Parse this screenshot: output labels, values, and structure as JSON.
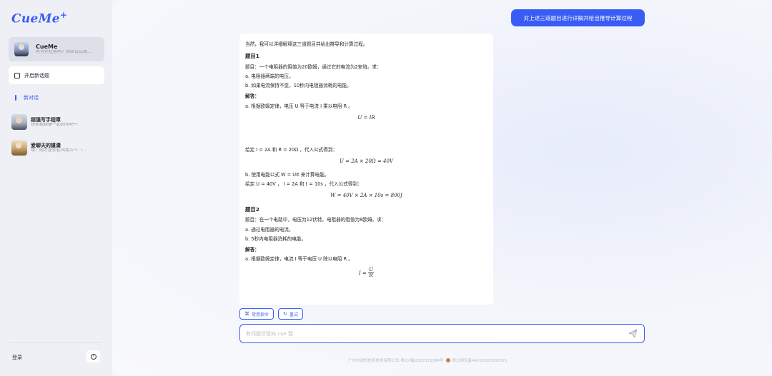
{
  "brand": {
    "logo": "CueMe",
    "logo_mark": "+",
    "accent": "#3a5cf6"
  },
  "sidebar": {
    "active_bot": {
      "name": "CueMe",
      "subtitle": "有写作任务吗？快来试试我...",
      "avatar": "avatar-cueme"
    },
    "new_topic_label": "开启新话题",
    "new_conversation_label": "新对话",
    "conversations": [
      {
        "name": "超强写手程章",
        "subtitle": "快来找程章一起创作吧～",
        "avatar": "avatar-boy"
      },
      {
        "name": "爱聊天的諶潇",
        "subtitle": "嘿？刚才是你在叫我么～（...",
        "avatar": "avatar-girl"
      }
    ],
    "login_label": "登录",
    "info_icon": "info-icon"
  },
  "chat": {
    "user_message": "对上述三道题目进行详解并给出推导计算过程",
    "answer": {
      "intro": "当然，我可以详细解释这三道题目并给出推导和计算过程。",
      "q1_title": "题目1",
      "q1_text": "题目：一个电阻器的阻值为20欧姆，通过它的电流为2安培。求：",
      "q1_a": "a. 电阻器两端的电压。",
      "q1_b": "b. 如果电流保持不变，10秒内电阻器消耗的电能。",
      "q1_solution_label": "解答：",
      "q1_sol_a": "a. 根据欧姆定律，电压 U 等于电流 I 乘以电阻 R 。",
      "q1_eq1": "U = IR",
      "q1_given1": "给定 I = 2A 和 R = 20Ω ，代入公式得到：",
      "q1_eq2": "U = 2A × 20Ω = 40V",
      "q1_sol_b": "b. 使用电能公式 W = UIt 来计算电能。",
      "q1_given2": "给定 U = 40V ， I = 2A 和 t = 10s ，代入公式得到：",
      "q1_eq3": "W = 40V × 2A × 10s = 800J",
      "q2_title": "题目2",
      "q2_text": "题目：在一个电路中，电压为12伏特，电阻器的阻值为8欧姆。求：",
      "q2_a": "a. 通过电阻器的电流。",
      "q2_b": "b. 5秒内电阻器消耗的电能。",
      "q2_solution_label": "解答：",
      "q2_sol_a": "a. 根据欧姆定律，电流 I 等于电压 U 除以电阻 R 。",
      "q2_eq_lhs": "I =",
      "q2_eq_num": "U",
      "q2_eq_den": "R"
    },
    "actions": [
      {
        "label": "常用指令",
        "icon": "command-icon"
      },
      {
        "label": "重试",
        "icon": "refresh-icon"
      }
    ],
    "input_placeholder": "有问题尽管向 cue 我",
    "send_icon": "send-icon"
  },
  "footer": {
    "company": "广州市动悦信息技术有限公司 粤ICP备2022013084号",
    "police": "粤公网安备44010502003055"
  }
}
